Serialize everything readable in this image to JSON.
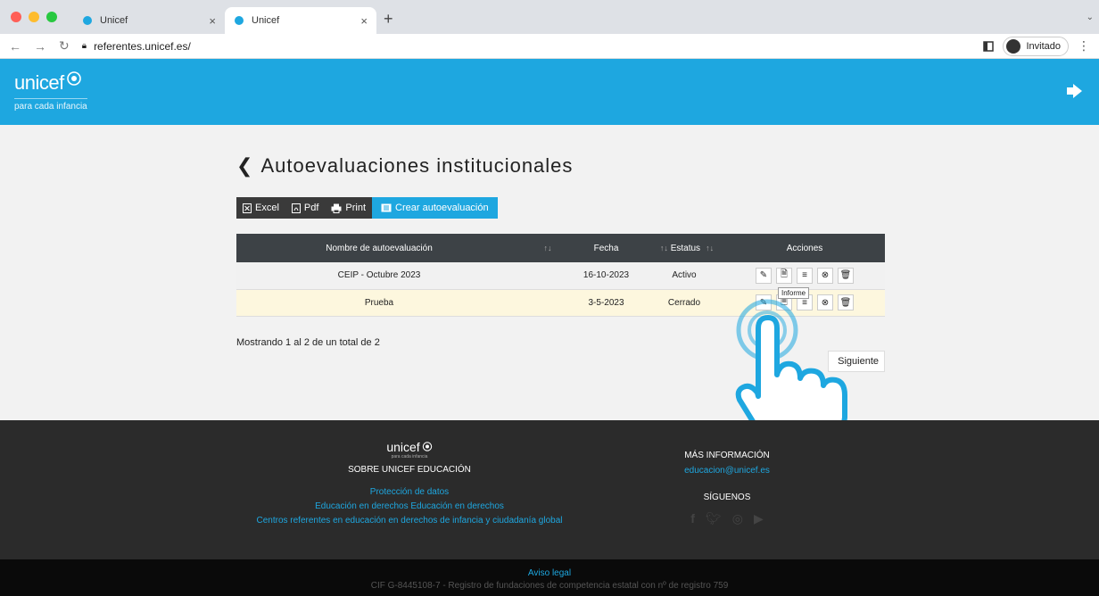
{
  "browser": {
    "traffic_colors": [
      "#ff5f57",
      "#febc2e",
      "#28c840"
    ],
    "tabs": [
      {
        "title": "Unicef",
        "active": false
      },
      {
        "title": "Unicef",
        "active": true
      }
    ],
    "close_glyph": "×",
    "new_tab_glyph": "+",
    "tab_list_glyph": "⌄",
    "url": "referentes.unicef.es/",
    "profile_label": "Invitado"
  },
  "header": {
    "logo_text": "unicef",
    "tagline": "para cada infancia",
    "brand_color": "#1ea7e0"
  },
  "page": {
    "title": "Autoevaluaciones institucionales",
    "toolbar": {
      "excel": "Excel",
      "pdf": "Pdf",
      "print": "Print",
      "create": "Crear autoevaluación"
    },
    "table": {
      "columns": [
        "Nombre de autoevaluación",
        "Fecha",
        "Estatus",
        "Acciones"
      ],
      "rows": [
        {
          "name": "CEIP - Octubre 2023",
          "date": "16-10-2023",
          "status": "Activo"
        },
        {
          "name": "Prueba",
          "date": "3-5-2023",
          "status": "Cerrado"
        }
      ]
    },
    "tooltip": "Informe",
    "showing": "Mostrando 1 al 2 de un total de 2",
    "next": "Siguiente"
  },
  "footer": {
    "logo_text": "unicef",
    "logo_tag": "para cada infancia",
    "about_heading": "SOBRE UNICEF EDUCACIÓN",
    "links": [
      "Protección de datos",
      "Educación en derechos Educación en derechos",
      "Centros referentes en educación en derechos de infancia y ciudadanía global"
    ],
    "more_heading": "MÁS INFORMACIÓN",
    "email": "educacion@unicef.es",
    "follow_heading": "SÍGUENOS",
    "aviso": "Aviso legal",
    "cif": "CIF G-8445108-7 - Registro de fundaciones de competencia estatal con nº de registro 759"
  }
}
